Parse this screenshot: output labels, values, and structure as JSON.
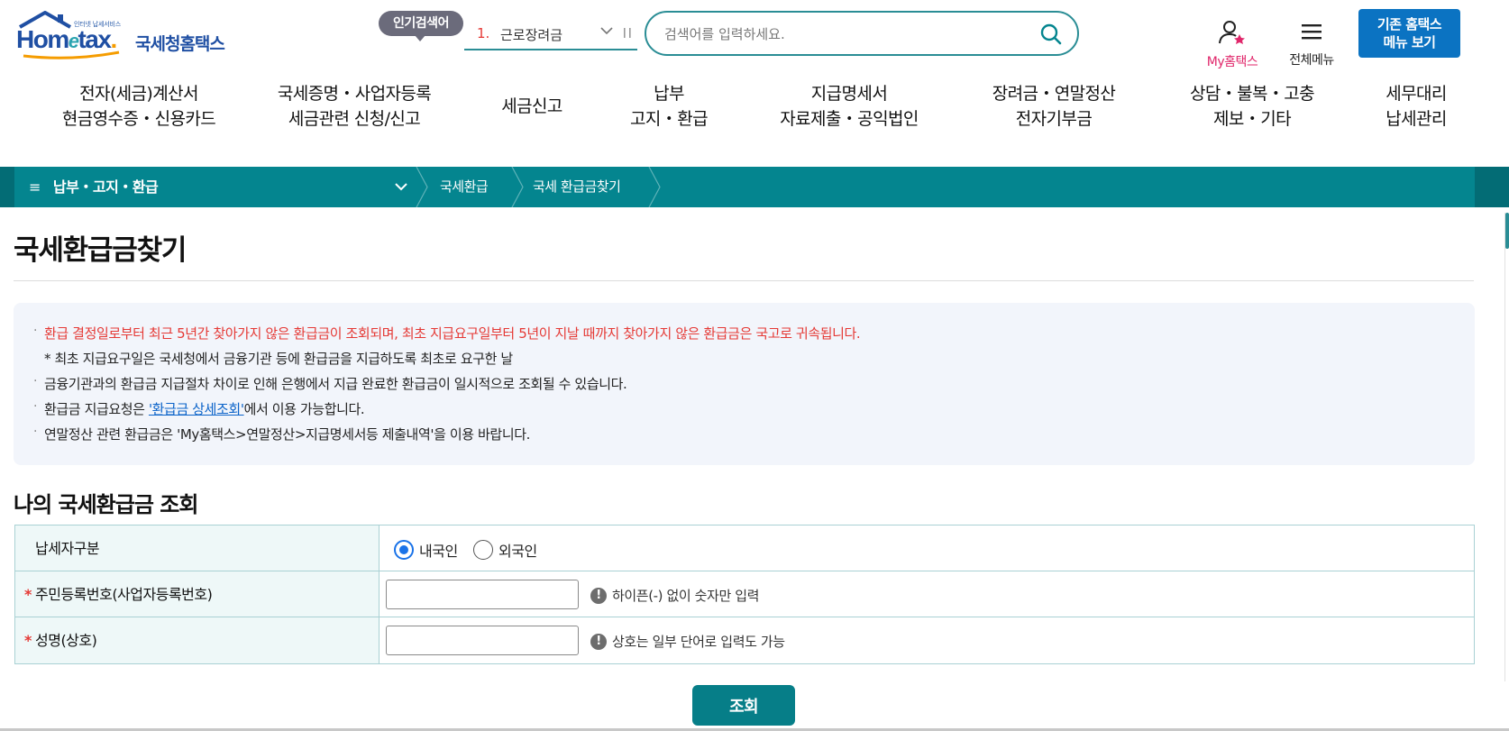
{
  "logo": {
    "tagline": "인터넷 납세서비스",
    "brand_en_1": "Hom",
    "brand_en_2": "e",
    "brand_en_3": "tax",
    "brand_kr": "국세청홈택스"
  },
  "header": {
    "popular_tag": "인기검색어",
    "popular_rank": "1.",
    "popular_word": "근로장려금",
    "search_placeholder": "검색어를 입력하세요.",
    "my_hometax": "My홈택스",
    "all_menu": "전체메뉴",
    "old_menu_line1": "기존 홈택스",
    "old_menu_line2": "메뉴 보기"
  },
  "gnb": [
    {
      "line1": "전자(세금)계산서",
      "line2": "현금영수증・신용카드"
    },
    {
      "line1": "국세증명・사업자등록",
      "line2": "세금관련 신청/신고"
    },
    {
      "line1": "세금신고",
      "line2": ""
    },
    {
      "line1": "납부",
      "line2": "고지・환급"
    },
    {
      "line1": "지급명세서",
      "line2": "자료제출・공익법인"
    },
    {
      "line1": "장려금・연말정산",
      "line2": "전자기부금"
    },
    {
      "line1": "상담・불복・고충",
      "line2": "제보・기타"
    },
    {
      "line1": "세무대리",
      "line2": "납세관리"
    }
  ],
  "breadcrumb": {
    "menu": "납부・고지・환급",
    "level2": "국세환급",
    "level3": "국세 환급금찾기"
  },
  "page": {
    "title": "국세환급금찾기",
    "section_title": "나의 국세환급금 조회",
    "submit": "조회"
  },
  "notice": {
    "line1": "환급 결정일로부터 최근 5년간 찾아가지 않은 환급금이 조회되며, 최초 지급요구일부터 5년이 지날 때까지 찾아가지 않은 환급금은 국고로 귀속됩니다.",
    "line2": "* 최초 지급요구일은 국세청에서 금융기관 등에 환급금을 지급하도록 최초로 요구한 날",
    "line3": "금융기관과의 환급금 지급절차 차이로 인해 은행에서 지급 완료한 환급금이 일시적으로 조회될 수 있습니다.",
    "line4_pre": "환급금 지급요청은 ",
    "line4_link": "'환급금 상세조회'",
    "line4_post": "에서 이용 가능합니다.",
    "line5": "연말정산 관련 환급금은 'My홈택스>연말정산>지급명세서등 제출내역'을 이용 바랍니다."
  },
  "form": {
    "taxpayer_type_label": "납세자구분",
    "option_domestic": "내국인",
    "option_foreign": "외국인",
    "selected": "내국인",
    "required_mark": "*",
    "id_label": "주민등록번호(사업자등록번호)",
    "id_value": "",
    "id_hint": "하이픈(-) 없이 숫자만 입력",
    "name_label": "성명(상호)",
    "name_value": "",
    "name_hint": "상호는 일부 단어로 입력도 가능",
    "hint_icon": "!"
  },
  "colors": {
    "teal": "#04858f",
    "brand_blue": "#1f4fa3",
    "notice_red": "#e53935",
    "button_blue": "#0b73c2"
  },
  "icons": [
    "search-icon",
    "user-star-icon",
    "hamburger-icon",
    "chevron-down-icon",
    "exclamation-icon"
  ]
}
